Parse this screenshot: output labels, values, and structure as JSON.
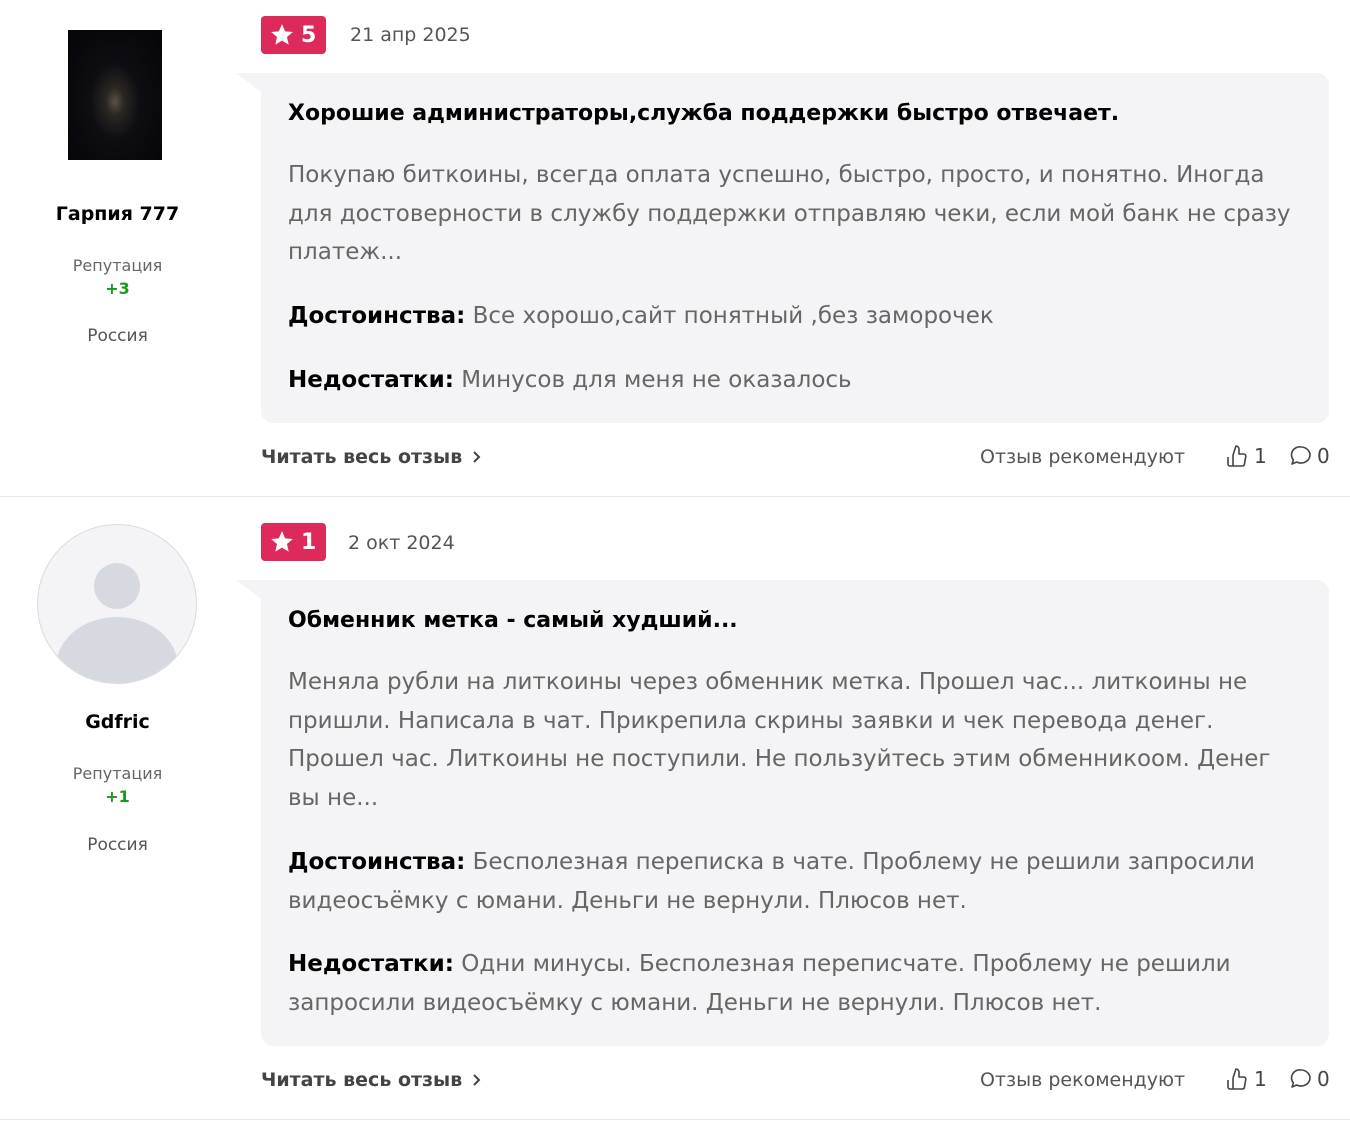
{
  "reviews": [
    {
      "author": {
        "name": "Гарпия 777",
        "reputation_label": "Репутация",
        "reputation_value": "+3",
        "country": "Россия"
      },
      "rating": "5",
      "date": "21 апр 2025",
      "title": "Хорошие администраторы,служба поддержки быстро отвечает.",
      "body": "Покупаю биткоины, всегда оплата успешно, быстро, просто, и понятно. Иногда для достоверности в службу поддержки отправляю чеки, если мой банк не сразу платеж...",
      "pros_label": "Достоинства:",
      "pros": "Все хорошо,сайт понятный ,без заморочек",
      "cons_label": "Недостатки:",
      "cons": "Минусов для меня не оказалось",
      "read_more": "Читать весь отзыв",
      "recommend_label": "Отзыв рекомендуют",
      "likes": "1",
      "comments": "0"
    },
    {
      "author": {
        "name": "Gdfric",
        "reputation_label": "Репутация",
        "reputation_value": "+1",
        "country": "Россия"
      },
      "rating": "1",
      "date": "2 окт 2024",
      "title": "Обменник метка - самый худший...",
      "body": "Меняла рубли на литкоины через обменник метка. Прошел час... литкоины не пришли. Написала в чат. Прикрепила скрины заявки и чек перевода денег. Прошел час. Литкоины не поступили. Не пользуйтесь этим обменникоом. Денег вы не...",
      "pros_label": "Достоинства:",
      "pros": "Бесполезная переписка в чате. Проблему не решили запросили видеосъёмку с юмани. Деньги не вернули. Плюсов нет.",
      "cons_label": "Недостатки:",
      "cons": "Одни минусы. Бесполезная переписчате. Проблему не решили запросили видеосъёмку с юмани. Деньги не вернули. Плюсов нет.",
      "read_more": "Читать весь отзыв",
      "recommend_label": "Отзыв рекомендуют",
      "likes": "1",
      "comments": "0"
    }
  ],
  "colors": {
    "badge": "#dd2a5a",
    "card": "#f4f4f6",
    "reputation": "#1a9a1a"
  },
  "icons": [
    "star-icon",
    "chevron-right-icon",
    "thumbs-up-icon",
    "comment-icon",
    "default-avatar-icon"
  ]
}
